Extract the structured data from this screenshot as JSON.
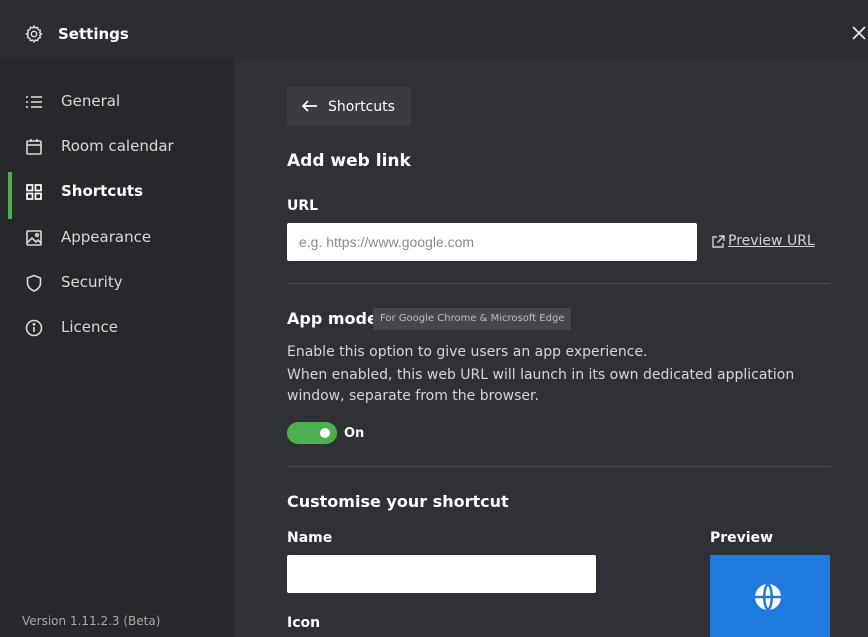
{
  "window": {
    "title": "Settings",
    "icon": "gear-icon",
    "close_icon": "close-icon"
  },
  "sidebar": {
    "items": [
      {
        "label": "General",
        "icon": "list-icon"
      },
      {
        "label": "Room calendar",
        "icon": "calendar-icon"
      },
      {
        "label": "Shortcuts",
        "icon": "grid-icon",
        "active": true
      },
      {
        "label": "Appearance",
        "icon": "image-icon"
      },
      {
        "label": "Security",
        "icon": "shield-icon"
      },
      {
        "label": "Licence",
        "icon": "info-icon"
      }
    ],
    "version": "Version 1.11.2.3 (Beta)"
  },
  "main": {
    "back_button": "Shortcuts",
    "heading": "Add web link",
    "url": {
      "label": "URL",
      "value": "",
      "placeholder": "e.g. https://www.google.com",
      "preview_link": "Preview URL"
    },
    "app_mode": {
      "label": "App mode",
      "badge": "For Google Chrome & Microsoft Edge",
      "description": [
        "Enable this option to give users an app experience.",
        "When enabled, this web URL will launch in its own dedicated application",
        "window, separate from the browser."
      ],
      "toggle_state": "On",
      "enabled": true
    },
    "customise": {
      "heading": "Customise your shortcut",
      "name_label": "Name",
      "name_value": "",
      "icon_label": "Icon",
      "preview_label": "Preview",
      "preview_icon": "globe-icon"
    }
  },
  "colors": {
    "accent": "#4caf50",
    "preview_tile": "#1f7ae0",
    "sidebar_bg": "#26282c",
    "main_bg": "#2f3136"
  }
}
